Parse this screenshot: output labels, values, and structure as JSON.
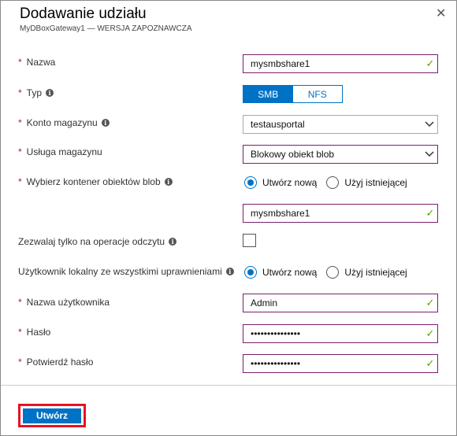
{
  "header": {
    "title": "Dodawanie udziału",
    "subtitle": "MyDBoxGateway1 — WERSJA ZAPOZNAWCZA",
    "close_glyph": "✕"
  },
  "form": {
    "required_mark": "*",
    "name": {
      "label": "Nazwa",
      "value": "mysmbshare1"
    },
    "type": {
      "label": "Typ",
      "options": [
        "SMB",
        "NFS"
      ],
      "selected": "SMB"
    },
    "storage_account": {
      "label": "Konto magazynu",
      "value": "testausportal"
    },
    "storage_service": {
      "label": "Usługa magazynu",
      "value": "Blokowy obiekt blob"
    },
    "container": {
      "label": "Wybierz kontener obiektów blob",
      "options": [
        "Utwórz nową",
        "Użyj istniejącej"
      ],
      "selected": "Utwórz nową",
      "value": "mysmbshare1"
    },
    "read_only": {
      "label": "Zezwalaj tylko na operacje odczytu",
      "checked": false
    },
    "local_user": {
      "label": "Użytkownik lokalny ze wszystkimi uprawnieniami",
      "options": [
        "Utwórz nową",
        "Użyj istniejącej"
      ],
      "selected": "Utwórz nową"
    },
    "username": {
      "label": "Nazwa użytkownika",
      "value": "Admin"
    },
    "password": {
      "label": "Hasło",
      "value": "•••••••••••••••"
    },
    "confirm_password": {
      "label": "Potwierdź hasło",
      "value": "•••••••••••••••"
    }
  },
  "footer": {
    "create_label": "Utwórz"
  },
  "icons": {
    "info": "info-icon",
    "check": "checkmark-icon",
    "chevron": "chevron-down-icon"
  },
  "colors": {
    "accent": "#0072c6",
    "valid": "#57a300",
    "required": "#a4262c",
    "highlight": "#e81123"
  }
}
